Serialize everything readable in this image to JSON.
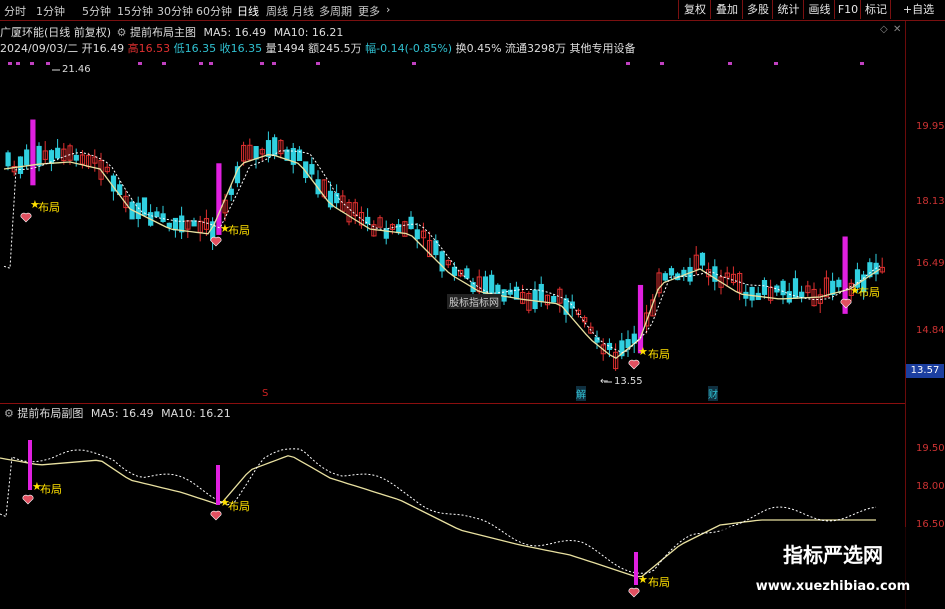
{
  "toolbar": {
    "timeframes": [
      "分时",
      "1分钟",
      "5分钟",
      "15分钟",
      "30分钟",
      "60分钟",
      "日线",
      "周线",
      "月线",
      "多周期",
      "更多"
    ],
    "buttons": [
      "复权",
      "叠加",
      "多股",
      "统计",
      "画线",
      "F10",
      "标记",
      "+自选"
    ]
  },
  "stock": {
    "name": "广厦环能(日线 前复权)",
    "indicator": "提前布局主图",
    "ma5": "MA5: 16.49",
    "ma10": "MA10: 16.21"
  },
  "quote": {
    "date": "2024/09/03/二",
    "open": "开16.49",
    "high": "高16.53",
    "low": "低16.35",
    "close": "收16.35",
    "volume": "量1494",
    "amount": "额245.5万",
    "change": "幅-0.14(-0.85%)",
    "turnover": "换0.45%",
    "float": "流通3298万",
    "sector": "其他专用设备"
  },
  "axis": {
    "main_ticks": [
      "19.95",
      "18.13",
      "16.49",
      "14.84"
    ],
    "sub_ticks": [
      "19.50",
      "18.00",
      "16.50"
    ],
    "current_price": "13.57"
  },
  "annotations": {
    "high_label": "21.46",
    "low_label": "13.55",
    "signal_label": "布局",
    "hover_label": "股标指标网",
    "event_s": "S",
    "event_jie": "解",
    "event_cai": "财"
  },
  "sub_panel": {
    "title": "提前布局副图",
    "ma5": "MA5: 16.49",
    "ma10": "MA10: 16.21"
  },
  "watermark": {
    "line1": "指标严选网",
    "line2": "www.xuezhibiao.com"
  },
  "colors": {
    "up": "#e03030",
    "down": "#30d0e0",
    "signal": "#e020e0",
    "ma_solid": "#e8e0a0",
    "ma_dotted": "#ffffff",
    "star": "#ffe000"
  }
}
